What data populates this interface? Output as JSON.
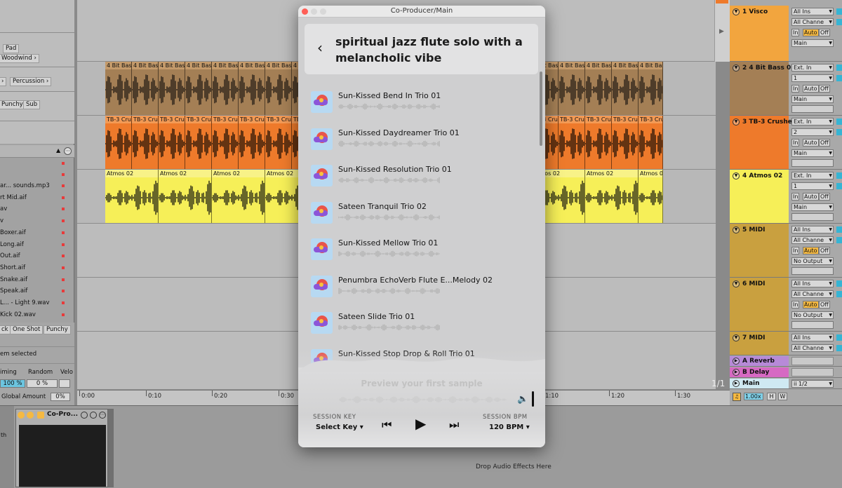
{
  "browser": {
    "tags_top": [
      "Pad",
      "Woodwind ›",
      "›",
      "Percussion ›",
      "Punchy",
      "Sub"
    ],
    "files": [
      "ar... sounds.mp3",
      "rt Mid.aif",
      "av",
      "v",
      "Boxer.aif",
      "Long.aif",
      "Out.aif",
      "Short.aif",
      "Snake.aif",
      "Speak.aif",
      "L... - Light 9.wav",
      "Kick 02.wav"
    ],
    "tags_bottom": [
      "ck",
      "One Shot",
      "Punchy"
    ],
    "selection_status": "em selected",
    "groove": {
      "timing_label": "iming",
      "random_label": "Random",
      "velocity_label": "Velo",
      "timing_value": "100 %",
      "random_value": "0 %"
    },
    "global_amount_label": "Global Amount",
    "global_amount_value": "0%"
  },
  "arrangement": {
    "clip_names": {
      "bass": "4 Bit Bas",
      "tb3": "TB-3 Cru",
      "atmos": "Atmos 02"
    },
    "ruler": [
      "0:00",
      "0:10",
      "0:20",
      "0:30",
      "1:10",
      "1:20",
      "1:30"
    ],
    "zoom_readout": "1/1"
  },
  "tracks": [
    {
      "name": "1 Visco",
      "color": "#f2a53e",
      "in": "All Ins",
      "ch": "All Channe",
      "out": "Main"
    },
    {
      "name": "2 4 Bit Bass 01",
      "color": "#a47f55",
      "in": "Ext. In",
      "ch": "1",
      "out": "Main"
    },
    {
      "name": "3 TB-3 Crushe",
      "color": "#ee7a2b",
      "in": "Ext. In",
      "ch": "2",
      "out": "Main"
    },
    {
      "name": "4 Atmos 02",
      "color": "#f6ef58",
      "in": "Ext. In",
      "ch": "1",
      "out": "Main"
    },
    {
      "name": "5 MIDI",
      "color": "#c9a03f",
      "in": "All Ins",
      "ch": "All Channe",
      "out": "No Output"
    },
    {
      "name": "6 MIDI",
      "color": "#c9a03f",
      "in": "All Ins",
      "ch": "All Channe",
      "out": "No Output"
    },
    {
      "name": "7 MIDI",
      "color": "#c9a03f",
      "in": "All Ins",
      "ch": "All Channe",
      "out": ""
    }
  ],
  "monitor_labels": {
    "in": "In",
    "auto": "Auto",
    "off": "Off"
  },
  "returns": [
    {
      "name": "A Reverb",
      "color": "#b78ad8"
    },
    {
      "name": "B Delay",
      "color": "#d669c3"
    },
    {
      "name": "Main",
      "color": "#cfe9f2"
    }
  ],
  "main_out": "ii 1/2",
  "tempo_field": "1.00x",
  "hw_buttons": [
    "H",
    "W"
  ],
  "device": {
    "name": "Co-Pro...",
    "drop_hint": "Drop Audio Effects Here",
    "left_label": "th"
  },
  "plugin": {
    "window_title": "Co-Producer/Main",
    "query": "spiritual jazz flute solo with a melancholic vibe",
    "results": [
      "Sun-Kissed Bend In Trio 01",
      "Sun-Kissed Daydreamer Trio 01",
      "Sun-Kissed Resolution Trio 01",
      "Sateen Tranquil Trio 02",
      "Sun-Kissed Mellow Trio 01",
      "Penumbra EchoVerb Flute E...Melody 02",
      "Sateen Slide Trio 01",
      "Sun-Kissed Stop Drop & Roll Trio 01"
    ],
    "preview_text": "Preview your first sample",
    "session_key_label": "SESSION KEY",
    "session_key_value": "Select Key",
    "session_bpm_label": "SESSION BPM",
    "session_bpm_value": "120 BPM",
    "icons": [
      "back-icon",
      "skip-back-icon",
      "play-icon",
      "skip-forward-icon",
      "speaker-icon"
    ]
  }
}
